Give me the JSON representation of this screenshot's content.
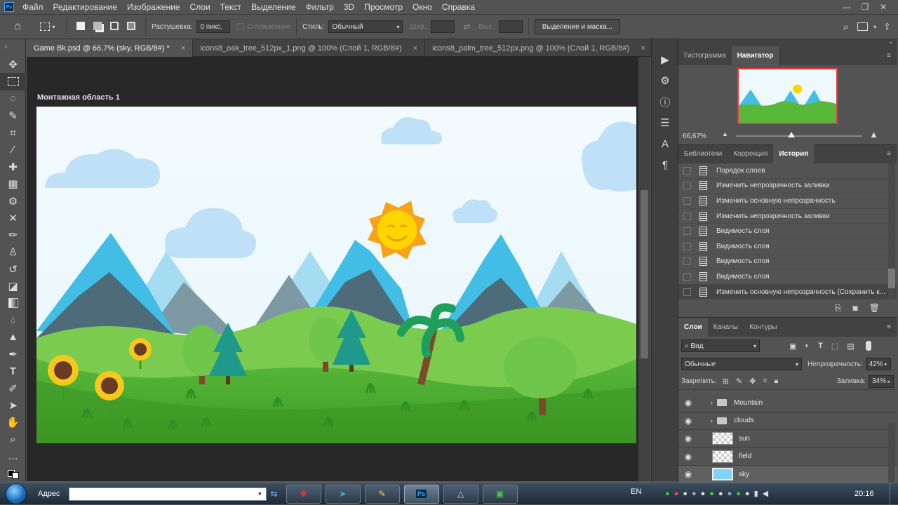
{
  "app": {
    "logo": "Ps"
  },
  "menu": [
    "Файл",
    "Редактирование",
    "Изображение",
    "Слои",
    "Текст",
    "Выделение",
    "Фильтр",
    "3D",
    "Просмотр",
    "Окно",
    "Справка"
  ],
  "window_controls": {
    "minimize": "—",
    "restore": "❐",
    "close": "✕"
  },
  "options": {
    "feather_label": "Растушевка:",
    "feather_value": "0 пикс.",
    "antialias_label": "Сглаживание",
    "style_label": "Стиль:",
    "style_value": "Обычный",
    "width_label": "Шир.:",
    "height_label": "Выс.:",
    "select_mask_button": "Выделение и маска..."
  },
  "tabs": [
    {
      "label": "Game Bk.psd @ 66,7% (sky, RGB/8#) *",
      "active": true
    },
    {
      "label": "icons8_oak_tree_512px_1.png @ 100% (Слой 1, RGB/8#)",
      "active": false
    },
    {
      "label": "icons8_palm_tree_512px.png @ 100% (Слой 1, RGB/8#)",
      "active": false
    }
  ],
  "artboard_label": "Монтажная область 1",
  "navigator": {
    "tabs": [
      "Гистограмма",
      "Навигатор"
    ],
    "active": "Навигатор",
    "zoom": "66,67%",
    "zoom_slider_fraction": 0.44
  },
  "history": {
    "tabs": [
      "Библиотеки",
      "Коррекция",
      "История"
    ],
    "active": "История",
    "items": [
      "Порядок слоев",
      "Изменить непрозрачность заливки",
      "Изменить основную непрозрачность",
      "Изменить непрозрачность заливки",
      "Видимость слоя",
      "Видимость слоя",
      "Видимость слоя",
      "Видимость слоя",
      "Изменить основную непрозрачность (Сохранить к..."
    ]
  },
  "layers": {
    "tabs": [
      "Слои",
      "Каналы",
      "Контуры"
    ],
    "active": "Слои",
    "filter": "Вид",
    "blend_mode": "Обычные",
    "opacity_label": "Непрозрачность:",
    "opacity": "42%",
    "lock_label": "Закрепить:",
    "fill_label": "Заливка:",
    "fill": "34%",
    "items": [
      {
        "name": "Mountain",
        "type": "group"
      },
      {
        "name": "clouds",
        "type": "group"
      },
      {
        "name": "sun",
        "type": "layer"
      },
      {
        "name": "field",
        "type": "layer"
      },
      {
        "name": "sky",
        "type": "layer",
        "selected": true
      }
    ]
  },
  "taskbar": {
    "address_label": "Адрес",
    "lang": "EN",
    "time": "20:16",
    "apps": [
      "app",
      "telegram",
      "notes",
      "photoshop",
      "app2",
      "app3"
    ],
    "active_app": "Ps"
  },
  "colors": {
    "sky": "#eef9fd",
    "grass": "#4cae2f",
    "accent_ps": "#31a8ff"
  }
}
